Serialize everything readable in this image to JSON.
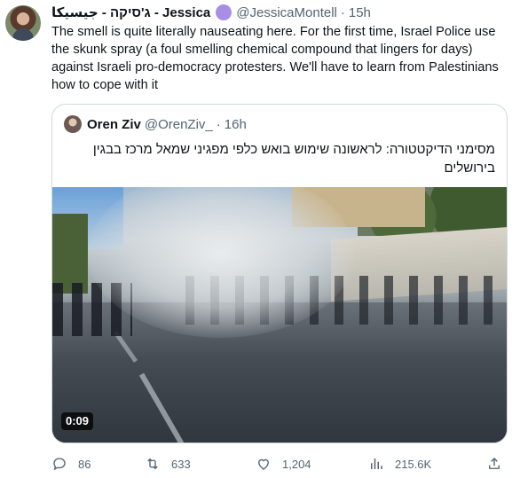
{
  "tweet": {
    "display_name": "ג'סיקה - جيسيكا - Jessica",
    "handle": "@JessicaMontell",
    "separator": "·",
    "time": "15h",
    "text": "The smell is quite literally nauseating here. For the first time, Israel Police use the skunk spray (a foul smelling chemical compound that lingers for days) against Israeli pro-democracy protesters. We'll have to learn from Palestinians how to cope with it",
    "verified_badge_color": "#a98ee6"
  },
  "quoted_tweet": {
    "display_name": "Oren Ziv",
    "handle": "@OrenZiv_",
    "separator": "·",
    "time": "16h",
    "text": "מסימני הדיקטטורה: לראשונה שימוש בואש כלפי מפגיני שמאל מרכז בבגין בירושלים",
    "media": {
      "type": "video",
      "duration": "0:09"
    }
  },
  "actions": {
    "reply": {
      "icon": "reply-icon",
      "count": "86"
    },
    "retweet": {
      "icon": "retweet-icon",
      "count": "633"
    },
    "like": {
      "icon": "heart-icon",
      "count": "1,204"
    },
    "views": {
      "icon": "views-icon",
      "count": "215.6K"
    },
    "share": {
      "icon": "share-icon"
    }
  },
  "colors": {
    "text": "#0f1419",
    "secondary": "#536471",
    "border": "#cfd9de"
  }
}
